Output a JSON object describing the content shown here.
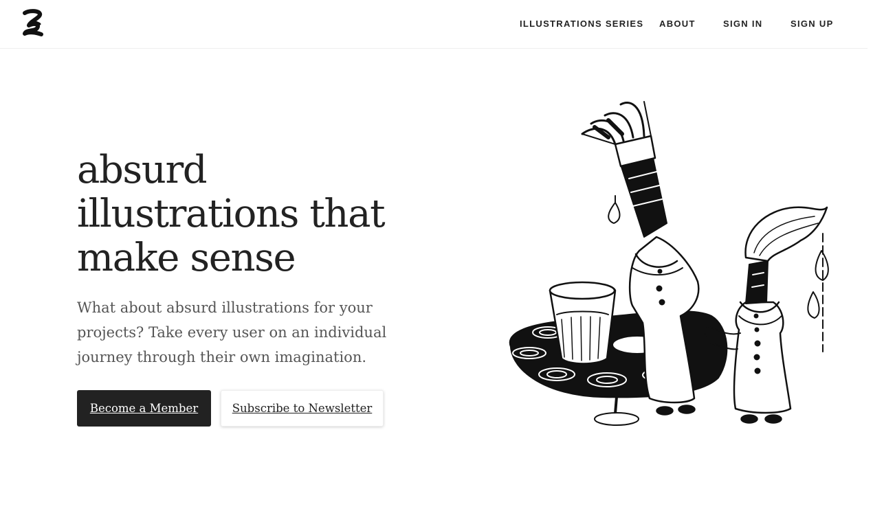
{
  "header": {
    "logo_icon": "squiggle-logo-icon",
    "nav": [
      {
        "label": "ILLUSTRATIONS SERIES"
      },
      {
        "label": "ABOUT"
      },
      {
        "label": "SIGN IN"
      },
      {
        "label": "SIGN UP"
      }
    ]
  },
  "hero": {
    "title_lines": [
      "absurd",
      "illustrations that",
      "make sense"
    ],
    "description": "What about absurd illustrations for your projects? Take every user on an individual journey through their own imagination.",
    "primary_button": "Become a Member",
    "secondary_button": "Subscribe to Newsletter"
  },
  "illustration": {
    "icon": "paintbrush-characters-palette-illustration"
  },
  "colors": {
    "text": "#222222",
    "muted_text": "#555555",
    "primary_button_bg": "#222222",
    "background": "#ffffff"
  }
}
